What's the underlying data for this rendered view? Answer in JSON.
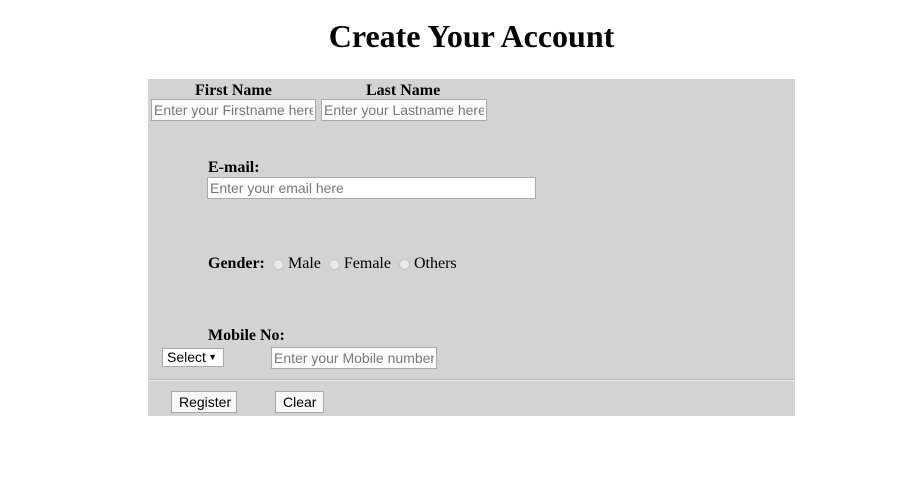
{
  "page": {
    "title": "Create Your Account"
  },
  "form": {
    "first_name": {
      "label": "First Name",
      "placeholder": "Enter your Firstname here",
      "value": ""
    },
    "last_name": {
      "label": "Last Name",
      "placeholder": "Enter your Lastname here",
      "value": ""
    },
    "email": {
      "label": "E-mail:",
      "placeholder": "Enter your email here",
      "value": ""
    },
    "gender": {
      "label": "Gender:",
      "options": [
        "Male",
        "Female",
        "Others"
      ],
      "selected": null
    },
    "mobile": {
      "label": "Mobile No:",
      "code_select": "Select",
      "placeholder": "Enter your Mobile number",
      "value": ""
    },
    "buttons": {
      "register": "Register",
      "clear": "Clear"
    }
  },
  "colors": {
    "panel_bg": "#d3d3d3",
    "page_bg": "#ffffff"
  },
  "icons": {
    "dropdown": "triangle-down-icon",
    "radio": "radio-unchecked-icon"
  }
}
